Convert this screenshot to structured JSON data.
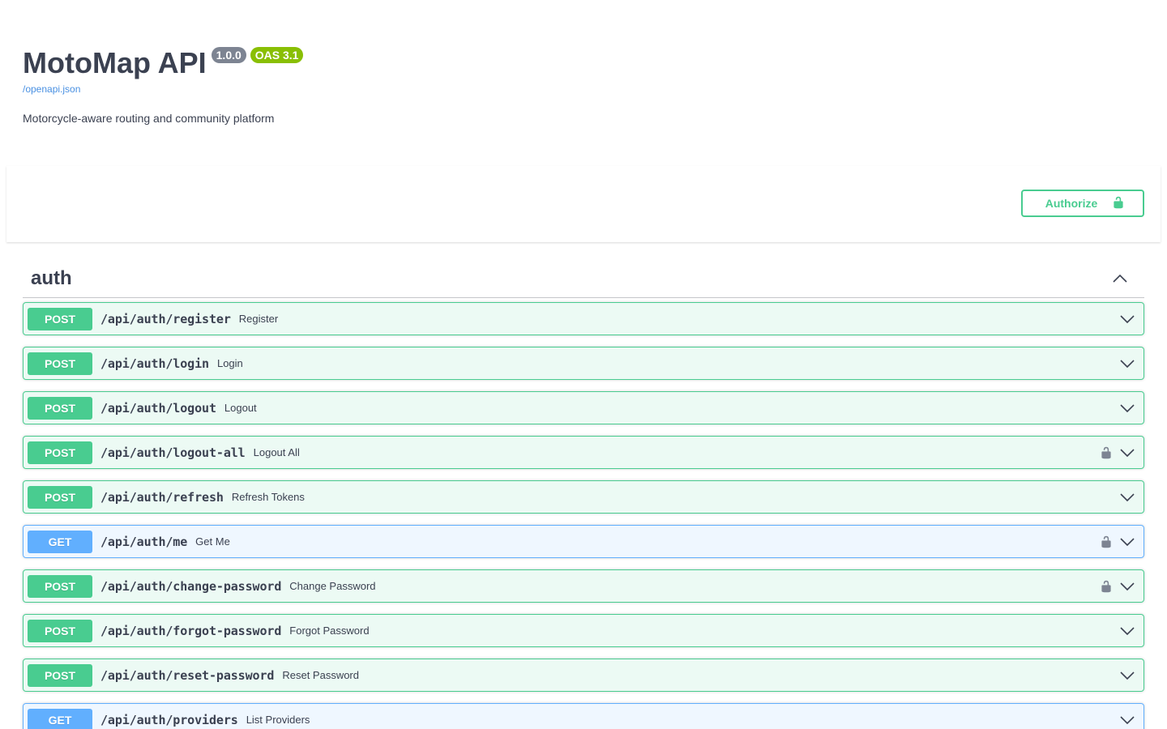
{
  "info": {
    "title": "MotoMap API",
    "version": "1.0.0",
    "oas": "OAS 3.1",
    "spec_link": "/openapi.json",
    "description": "Motorcycle-aware routing and community platform"
  },
  "scheme": {
    "authorize_label": "Authorize"
  },
  "tag": {
    "name": "auth"
  },
  "colors": {
    "post": "#49cc90",
    "get": "#61affe"
  },
  "operations": [
    {
      "method": "POST",
      "path": "/api/auth/register",
      "summary": "Register",
      "locked": false
    },
    {
      "method": "POST",
      "path": "/api/auth/login",
      "summary": "Login",
      "locked": false
    },
    {
      "method": "POST",
      "path": "/api/auth/logout",
      "summary": "Logout",
      "locked": false
    },
    {
      "method": "POST",
      "path": "/api/auth/logout-all",
      "summary": "Logout All",
      "locked": true
    },
    {
      "method": "POST",
      "path": "/api/auth/refresh",
      "summary": "Refresh Tokens",
      "locked": false
    },
    {
      "method": "GET",
      "path": "/api/auth/me",
      "summary": "Get Me",
      "locked": true
    },
    {
      "method": "POST",
      "path": "/api/auth/change-password",
      "summary": "Change Password",
      "locked": true
    },
    {
      "method": "POST",
      "path": "/api/auth/forgot-password",
      "summary": "Forgot Password",
      "locked": false
    },
    {
      "method": "POST",
      "path": "/api/auth/reset-password",
      "summary": "Reset Password",
      "locked": false
    },
    {
      "method": "GET",
      "path": "/api/auth/providers",
      "summary": "List Providers",
      "locked": false
    }
  ]
}
